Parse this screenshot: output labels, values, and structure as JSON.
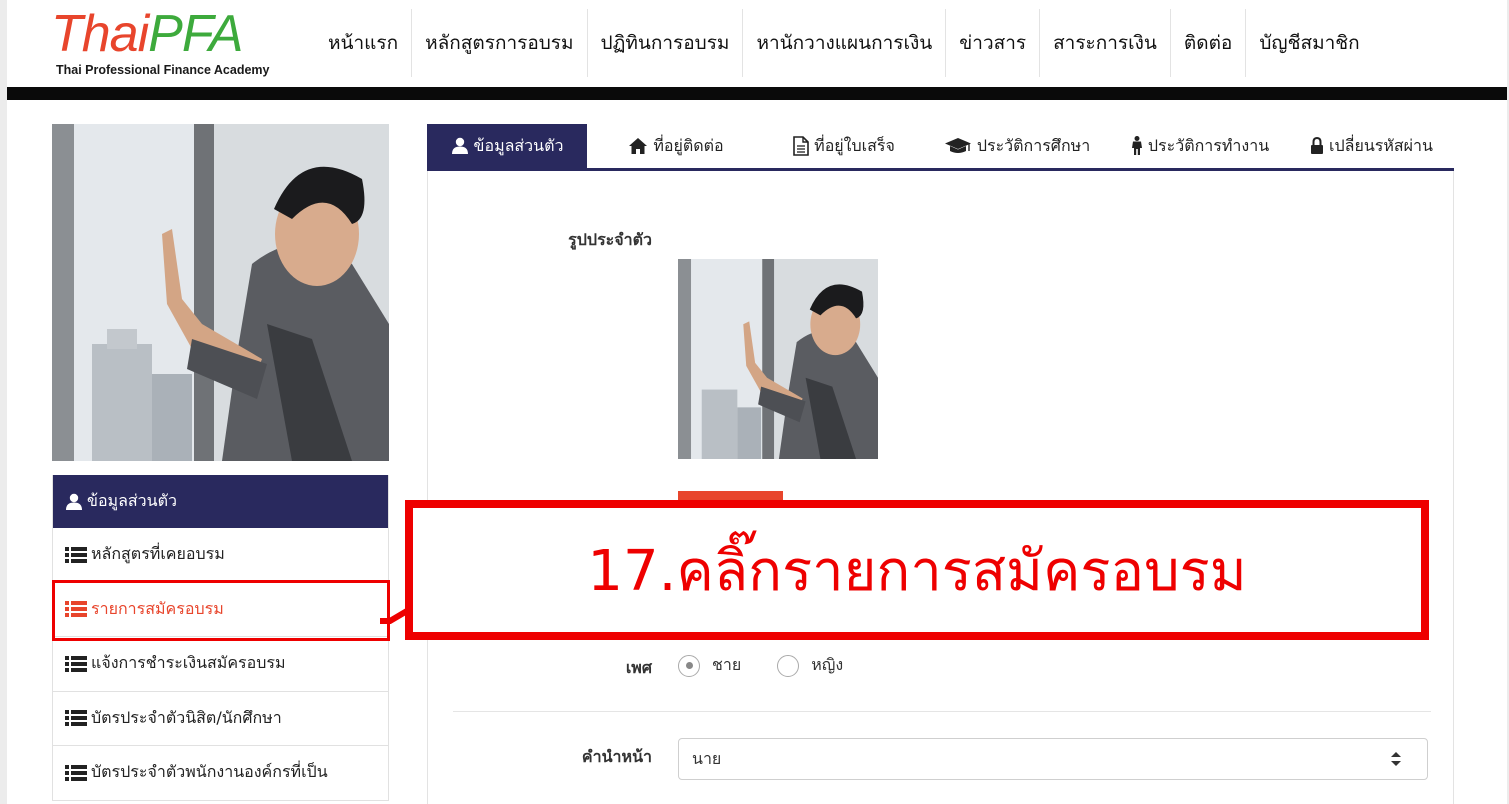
{
  "logo": {
    "brand_left": "Thai",
    "brand_right": "PFA",
    "subtitle": "Thai Professional Finance Academy"
  },
  "nav": {
    "items": [
      "หน้าแรก",
      "หลักสูตรการอบรม",
      "ปฏิทินการอบรม",
      "หานักวางแผนการเงิน",
      "ข่าวสาร",
      "สาระการเงิน",
      "ติดต่อ",
      "บัญชีสมาชิก"
    ]
  },
  "sidebar": {
    "header": "ข้อมูลส่วนตัว",
    "items": [
      "หลักสูตรที่เคยอบรม",
      "รายการสมัครอบรม",
      "แจ้งการชำระเงินสมัครอบรม",
      "บัตรประจำตัวนิสิต/นักศึกษา",
      "บัตรประจำตัวพนักงานองค์กรที่เป็น"
    ],
    "active_index": 1
  },
  "tabs": {
    "items": [
      "ข้อมูลส่วนตัว",
      "ที่อยู่ติดต่อ",
      "ที่อยู่ใบเสร็จ",
      "ประวัติการศึกษา",
      "ประวัติการทำงาน",
      "เปลี่ยนรหัสผ่าน"
    ],
    "icons": [
      "user-icon",
      "home-icon",
      "document-icon",
      "graduation-cap-icon",
      "person-icon",
      "lock-icon"
    ],
    "active_index": 0
  },
  "form": {
    "photo_label": "รูปประจำตัว",
    "gender_label": "เพศ",
    "gender_options": [
      "ชาย",
      "หญิง"
    ],
    "gender_selected": "ชาย",
    "title_label": "คำนำหน้า",
    "title_value": "นาย"
  },
  "annotation": {
    "text": "17.คลิ๊กรายการสมัครอบรม"
  },
  "colors": {
    "navy": "#29295e",
    "accent": "#e8452c",
    "logo_green": "#3daa3c",
    "annotation_red": "#ee0000"
  }
}
